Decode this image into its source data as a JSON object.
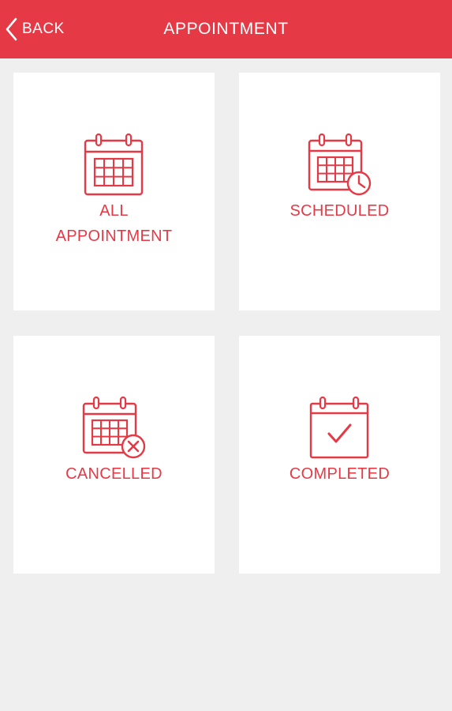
{
  "header": {
    "back_label": "BACK",
    "title": "APPOINTMENT",
    "background_color": "#e63946"
  },
  "cards": [
    {
      "label_line1": "ALL",
      "label_line2": "APPOINTMENT",
      "icon": "calendar-grid-icon"
    },
    {
      "label": "SCHEDULED",
      "icon": "calendar-clock-icon"
    },
    {
      "label": "CANCELLED",
      "icon": "calendar-cancel-icon"
    },
    {
      "label": "COMPLETED",
      "icon": "calendar-check-icon"
    }
  ],
  "colors": {
    "accent": "#e63946",
    "card_background": "#ffffff",
    "page_background": "#efefef"
  }
}
